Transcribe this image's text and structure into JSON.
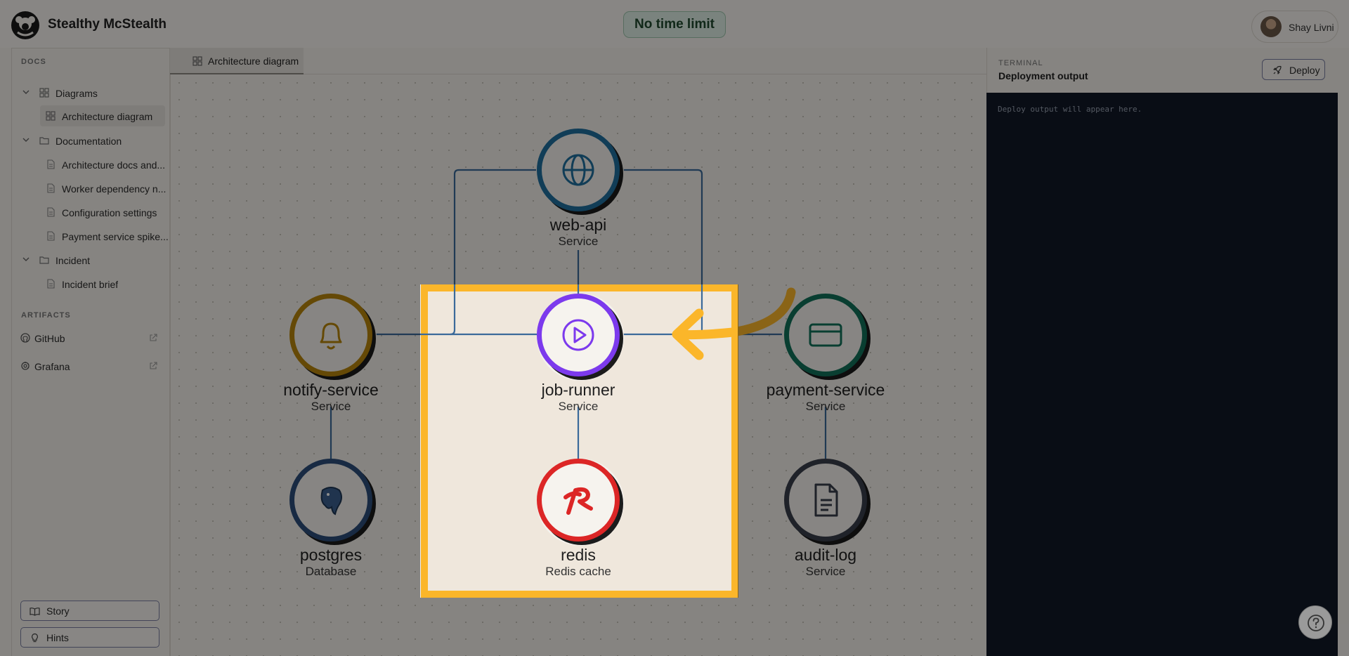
{
  "app": {
    "title": "Stealthy McStealth"
  },
  "header": {
    "time_badge": "No time limit",
    "user_name": "Shay Livni"
  },
  "sidebar": {
    "docs_label": "DOCS",
    "tree": [
      {
        "label": "Diagrams",
        "kind": "folder-group",
        "icon": "grid-icon"
      },
      {
        "label": "Architecture diagram",
        "kind": "item",
        "icon": "grid-icon",
        "active": true
      },
      {
        "label": "Documentation",
        "kind": "folder",
        "icon": "folder-icon"
      },
      {
        "label": "Architecture docs and...",
        "kind": "item",
        "icon": "file-icon"
      },
      {
        "label": "Worker dependency n...",
        "kind": "item",
        "icon": "file-icon"
      },
      {
        "label": "Configuration settings",
        "kind": "item",
        "icon": "file-icon"
      },
      {
        "label": "Payment service spike...",
        "kind": "item",
        "icon": "file-icon"
      },
      {
        "label": "Incident",
        "kind": "folder",
        "icon": "folder-icon"
      },
      {
        "label": "Incident brief",
        "kind": "item",
        "icon": "file-icon"
      }
    ],
    "artifacts_label": "ARTIFACTS",
    "artifacts": [
      {
        "label": "GitHub",
        "icon": "github-icon"
      },
      {
        "label": "Grafana",
        "icon": "grafana-icon"
      }
    ],
    "story_button": "Story",
    "hints_button": "Hints"
  },
  "tabs": [
    {
      "label": "Architecture diagram",
      "active": true
    }
  ],
  "diagram": {
    "nodes": [
      {
        "name": "web-api",
        "type": "Service",
        "icon": "globe-icon",
        "color": "#1f6f9e"
      },
      {
        "name": "notify-service",
        "type": "Service",
        "icon": "bell-icon",
        "color": "#b8860b"
      },
      {
        "name": "job-runner",
        "type": "Service",
        "icon": "play-icon",
        "color": "#7c3aed"
      },
      {
        "name": "payment-service",
        "type": "Service",
        "icon": "credit-card-icon",
        "color": "#11715a"
      },
      {
        "name": "postgres",
        "type": "Database",
        "icon": "postgres-icon",
        "color": "#2d4e7a"
      },
      {
        "name": "redis",
        "type": "Redis cache",
        "icon": "redis-icon",
        "color": "#dc2626"
      },
      {
        "name": "audit-log",
        "type": "Service",
        "icon": "document-icon",
        "color": "#3a3f4b"
      }
    ],
    "highlight_color": "#fbb62a",
    "edge_color": "#3b6a9a"
  },
  "terminal": {
    "label": "TERMINAL",
    "title": "Deployment output",
    "deploy_button": "Deploy",
    "output": "Deploy output will appear here."
  }
}
